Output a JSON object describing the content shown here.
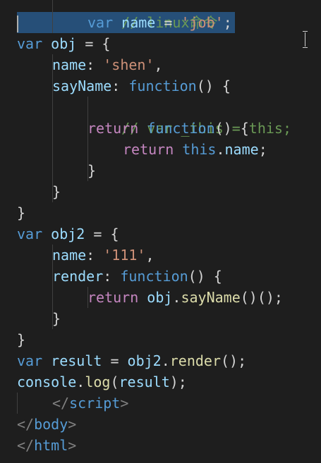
{
  "code": {
    "line1_comment": "// linux命令",
    "line2": {
      "kw": "var",
      "ident": "name",
      "op": " = ",
      "str": "'job'",
      "end": ";"
    },
    "line3": {
      "kw": "var",
      "ident": "obj",
      "rest": " = {"
    },
    "line4": {
      "key": "name",
      "colon": ": ",
      "str": "'shen'",
      "end": ","
    },
    "line5": {
      "key": "sayName",
      "colon": ": ",
      "kw": "function",
      "rest": "() {"
    },
    "line6_comment": "// var _this = this;",
    "line7": {
      "kw": "return",
      "kw2": "function",
      "rest": "() {"
    },
    "line8": {
      "kw": "return",
      "this": "this",
      "dot": ".",
      "prop": "name",
      "end": ";"
    },
    "line9": "}",
    "line10": "}",
    "line11": "}",
    "line12": {
      "kw": "var",
      "ident": "obj2",
      "rest": " = {"
    },
    "line13": {
      "key": "name",
      "colon": ": ",
      "str": "'111'",
      "end": ","
    },
    "line14": {
      "key": "render",
      "colon": ": ",
      "kw": "function",
      "rest": "() {"
    },
    "line15": {
      "kw": "return",
      "obj": "obj",
      "dot": ".",
      "method": "sayName",
      "rest": "()();"
    },
    "line16": "}",
    "line17": "}",
    "line18": {
      "kw": "var",
      "ident": "result",
      "op": " = ",
      "obj": "obj2",
      "dot": ".",
      "method": "render",
      "rest": "();"
    },
    "line19": {
      "obj": "console",
      "dot": ".",
      "method": "log",
      "open": "(",
      "arg": "result",
      "rest": ");"
    },
    "line20": {
      "open": "</",
      "tag": "script",
      "close": ">"
    },
    "line21": {
      "open": "</",
      "tag": "body",
      "close": ">"
    },
    "line22": {
      "open": "</",
      "tag": "html",
      "close": ">"
    }
  },
  "colors": {
    "background": "#1e1e1e",
    "selection": "#264f78",
    "keyword": "#569cd6",
    "control": "#c586c0",
    "variable": "#9cdcfe",
    "function": "#dcdcaa",
    "string": "#ce9178",
    "comment": "#6a9955"
  }
}
